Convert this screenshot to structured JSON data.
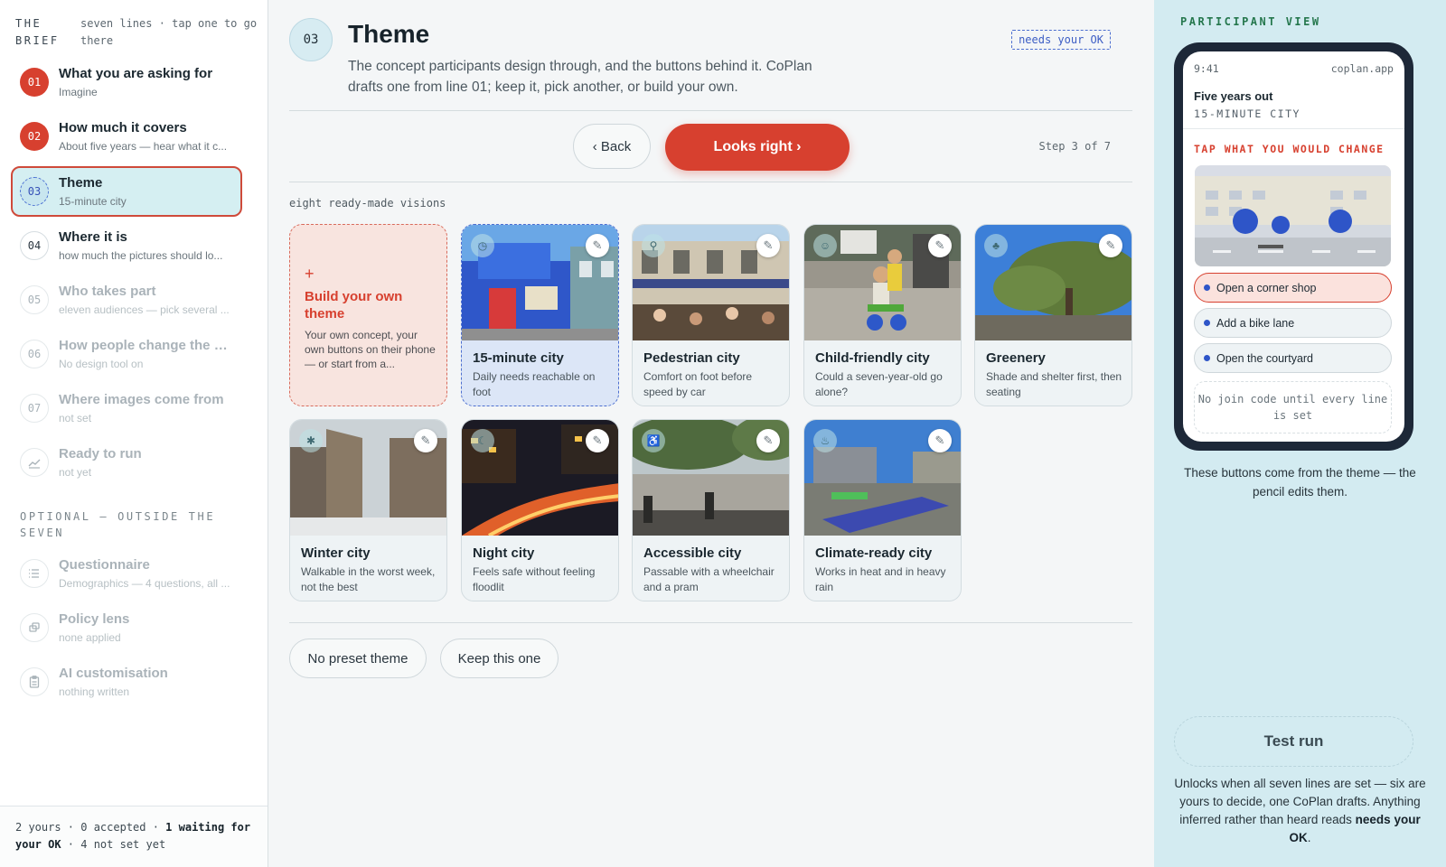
{
  "sidebar": {
    "brief_title": "THE BRIEF",
    "brief_subtitle": "seven lines · tap one to go there",
    "items": [
      {
        "num": "01",
        "title": "What you are asking for",
        "sub": "Imagine"
      },
      {
        "num": "02",
        "title": "How much it covers",
        "sub": "About five years — hear what it c..."
      },
      {
        "num": "03",
        "title": "Theme",
        "sub": "15-minute city"
      },
      {
        "num": "04",
        "title": "Where it is",
        "sub": "how much the pictures should lo..."
      },
      {
        "num": "05",
        "title": "Who takes part",
        "sub": "eleven audiences — pick several ..."
      },
      {
        "num": "06",
        "title": "How people change the pi...",
        "sub": "No design tool on"
      },
      {
        "num": "07",
        "title": "Where images come from",
        "sub": "not set"
      },
      {
        "title": "Ready to run",
        "sub": "not yet",
        "icon": "chart-icon"
      }
    ],
    "optional_heading": "OPTIONAL — OUTSIDE THE SEVEN",
    "optional_items": [
      {
        "title": "Questionnaire",
        "sub": "Demographics — 4 questions, all ...",
        "icon": "list-icon"
      },
      {
        "title": "Policy lens",
        "sub": "none applied",
        "icon": "lens-icon"
      },
      {
        "title": "AI customisation",
        "sub": "nothing written",
        "icon": "clipboard-icon"
      }
    ],
    "footer": {
      "p1": "2 yours · 0 accepted · ",
      "b1": "1 waiting for your OK",
      "p2": " · 4 not set yet"
    }
  },
  "main": {
    "step_number": "03",
    "title": "Theme",
    "description": "The concept participants design through, and the buttons behind it. CoPlan drafts one from line 01; keep it, pick another, or build your own.",
    "needs_ok": "needs your OK",
    "back_label": "‹ Back",
    "confirm_label": "Looks right ›",
    "step_count": "Step 3 of 7",
    "visions_label": "eight ready-made visions",
    "build_card": {
      "plus": "+",
      "title": "Build your own theme",
      "desc": "Your own concept, your own buttons on their phone — or start from a..."
    },
    "cards": [
      {
        "title": "15-minute city",
        "desc": "Daily needs reachable on foot",
        "icon": "clock-icon"
      },
      {
        "title": "Pedestrian city",
        "desc": "Comfort on foot before speed by car",
        "icon": "walker-icon"
      },
      {
        "title": "Child-friendly city",
        "desc": "Could a seven-year-old go alone?",
        "icon": "child-icon"
      },
      {
        "title": "Greenery",
        "desc": "Shade and shelter first, then seating",
        "icon": "tree-icon"
      },
      {
        "title": "Winter city",
        "desc": "Walkable in the worst week, not the best",
        "icon": "snowflake-icon"
      },
      {
        "title": "Night city",
        "desc": "Feels safe without feeling floodlit",
        "icon": "moon-icon"
      },
      {
        "title": "Accessible city",
        "desc": "Passable with a wheelchair and a pram",
        "icon": "wheelchair-icon"
      },
      {
        "title": "Climate-ready city",
        "desc": "Works in heat and in heavy rain",
        "icon": "thermometer-icon"
      }
    ],
    "pencil_glyph": "✎",
    "no_preset_label": "No preset theme",
    "keep_label": "Keep this one"
  },
  "preview": {
    "heading": "PARTICIPANT VIEW",
    "phone": {
      "time": "9:41",
      "site": "coplan.app",
      "heading": "Five years out",
      "theme": "15-MINUTE CITY",
      "tap_label": "TAP WHAT YOU WOULD CHANGE",
      "options": [
        "Open a corner shop",
        "Add a bike lane",
        "Open the courtyard"
      ],
      "no_code": "No join code until every line is set"
    },
    "note": "These buttons come from the theme — the pencil edits them.",
    "test_run_label": "Test run",
    "unlock_text": "Unlocks when all seven lines are set — six are yours to decide, one CoPlan drafts. Anything inferred rather than heard reads ",
    "unlock_bold": "needs your OK",
    "unlock_end": "."
  },
  "colors": {
    "accent": "#d7402f",
    "selection": "#4d6fd0",
    "panel": "#d3ebf1",
    "green_label": "#25774d"
  }
}
